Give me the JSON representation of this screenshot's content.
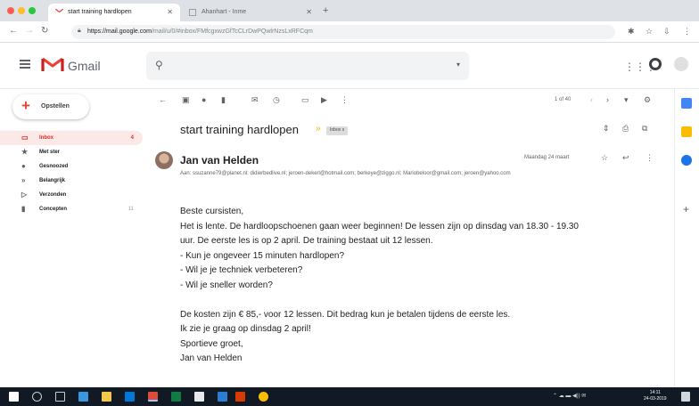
{
  "browser": {
    "tabs": [
      {
        "label": "start training hardlopen",
        "active": true
      },
      {
        "label": "Ahanhart - Inme",
        "active": false
      }
    ],
    "url_host": "https://mail.google.com",
    "url_path": "/mail/u/0/#inbox/FMfcgxwzGfTcCLrDwPQwlrNzsLxRFCqm"
  },
  "gmail": {
    "product_name": "Gmail",
    "compose_label": "Opstellen",
    "nav": [
      {
        "label": "Inbox",
        "count": "4",
        "icon": "inbox-icon"
      },
      {
        "label": "Met ster",
        "count": "",
        "icon": "star-icon"
      },
      {
        "label": "Gesnoozed",
        "count": "",
        "icon": "clock-icon"
      },
      {
        "label": "Belangrijk",
        "count": "",
        "icon": "important-icon"
      },
      {
        "label": "Verzonden",
        "count": "",
        "icon": "send-icon"
      },
      {
        "label": "Concepten",
        "count": "11",
        "icon": "draft-icon"
      }
    ],
    "pager": "1 of 40"
  },
  "message": {
    "subject": "start training hardlopen",
    "label_chip": "Inbox x",
    "sender_name": "Jan van Helden",
    "recipients": "Aan: ssuzanne79@planet.nl; didierbedlive.nl; jeroen-dekerl@hotmail.com; berkeye@ziggo.nl; Mariobeloor@gmail.com; jeroen@yahoo.com",
    "date": "Maandag 24 maart",
    "body_lines": [
      "Beste cursisten,",
      "Het is lente. De hardloopschoenen gaan weer beginnen! De lessen zijn op dinsdag van 18.30 - 19.30",
      "uur. De eerste les is op 2 april. De training bestaat uit 12 lessen.",
      "- Kun je ongeveer 15 minuten hardlopen?",
      "- Wil je je techniek verbeteren?",
      "- Wil je sneller worden?",
      "",
      "De kosten zijn € 85,- voor 12 lessen. Dit bedrag kun je betalen tijdens de eerste les.",
      "Ik zie je graag op dinsdag 2 april!",
      "Sportieve groet,",
      "Jan van Helden"
    ]
  },
  "taskbar": {
    "clock_time": "14:11",
    "clock_date": "24-03-2019"
  },
  "colors": {
    "accent_red": "#d93025",
    "gmail_red": "#ea4335",
    "active_bg": "#fce8e6",
    "taskbar": "#101924"
  }
}
